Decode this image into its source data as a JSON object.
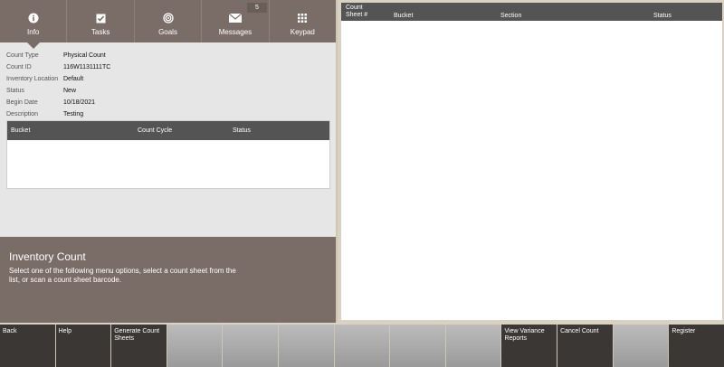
{
  "tabs": [
    {
      "label": "Info",
      "icon": "info-icon"
    },
    {
      "label": "Tasks",
      "icon": "checkbox-icon"
    },
    {
      "label": "Goals",
      "icon": "target-icon"
    },
    {
      "label": "Messages",
      "icon": "envelope-icon"
    },
    {
      "label": "Keypad",
      "icon": "keypad-icon"
    }
  ],
  "messages_badge": "5",
  "info": [
    {
      "key": "Count Type",
      "value": "Physical Count"
    },
    {
      "key": "Count ID",
      "value": "116W1131111TC"
    },
    {
      "key": "Inventory Location",
      "value": "Default"
    },
    {
      "key": "Status",
      "value": "New"
    },
    {
      "key": "Begin Date",
      "value": "10/18/2021"
    },
    {
      "key": "Description",
      "value": "Testing"
    }
  ],
  "left_table": {
    "headers": [
      "Bucket",
      "Count Cycle",
      "Status"
    ]
  },
  "description": {
    "title": "Inventory Count",
    "text": "Select one of the following menu options, select a count sheet from the list, or scan a count sheet barcode."
  },
  "right_table": {
    "headers": [
      "Count Sheet #",
      "Bucket",
      "Section",
      "Status"
    ]
  },
  "buttons": [
    "Back",
    "Help",
    "Generate Count Sheets",
    "",
    "",
    "",
    "",
    "",
    "",
    "View Variance Reports",
    "Cancel Count",
    "",
    "Register"
  ],
  "colors": {
    "header": "#7a6d68",
    "table_header": "#545454",
    "button": "#3a3735",
    "background": "#d9d1c2"
  }
}
